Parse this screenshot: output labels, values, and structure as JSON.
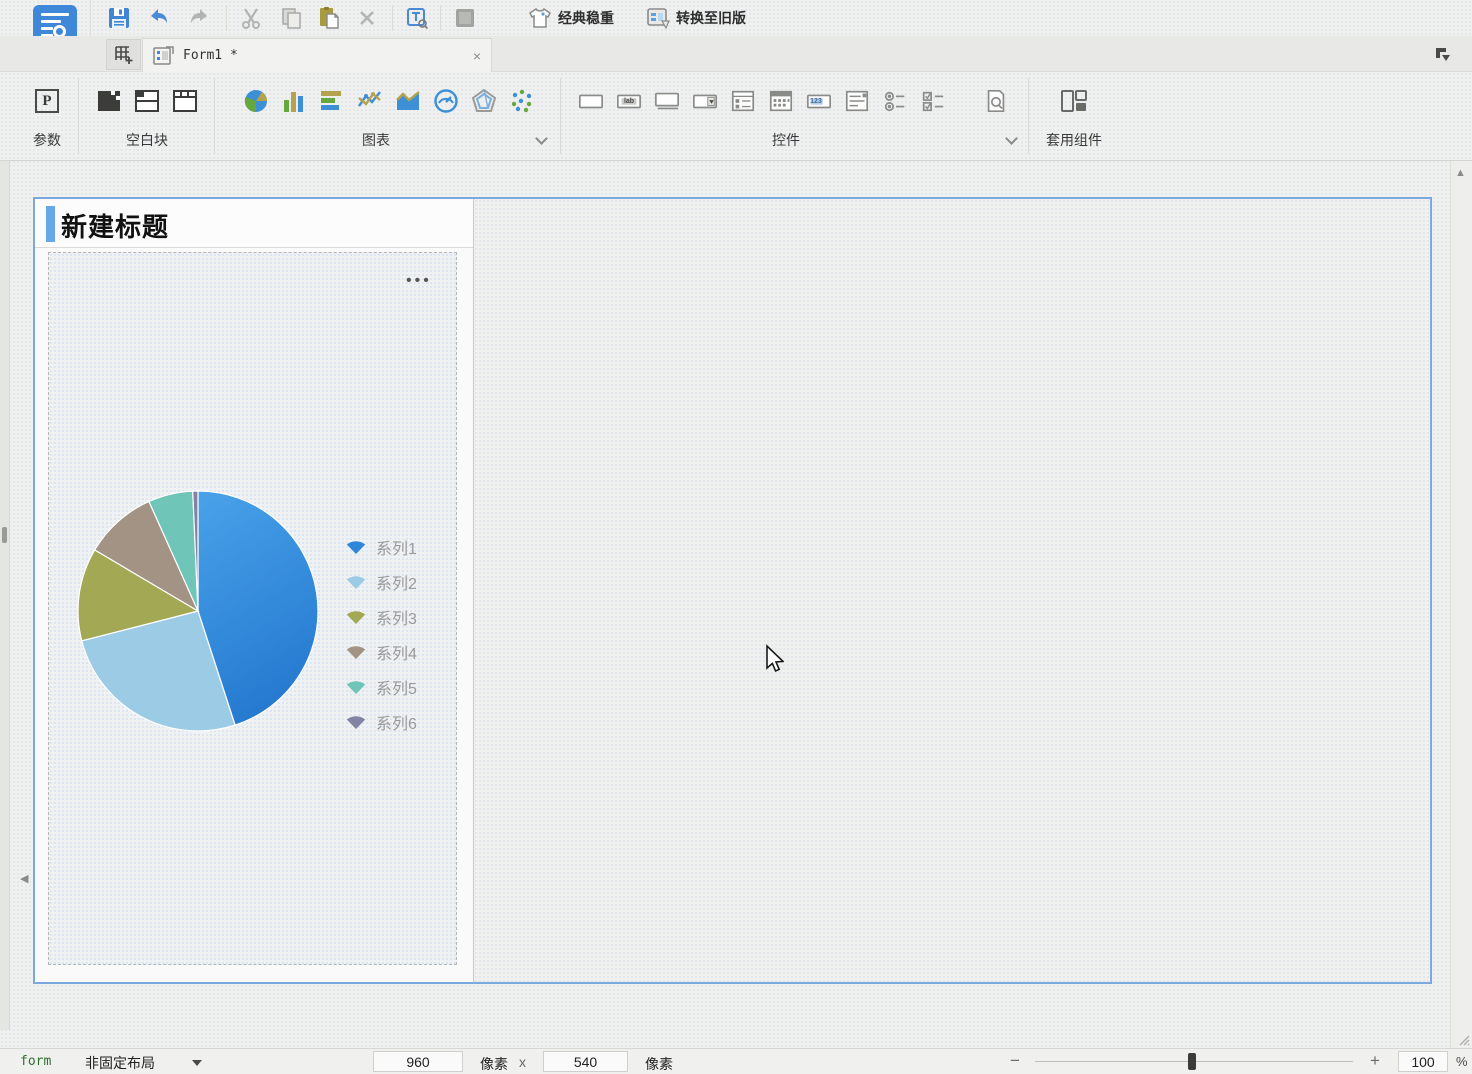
{
  "toolbar": {
    "theme_label": "经典稳重",
    "convert_label": "转换至旧版"
  },
  "tab": {
    "title": "Form1 *",
    "close": "×"
  },
  "ribbon": {
    "groups": [
      {
        "label": "参数"
      },
      {
        "label": "空白块"
      },
      {
        "label": "图表"
      },
      {
        "label": "控件"
      },
      {
        "label": "套用组件"
      }
    ],
    "icon_text": {
      "param_letter": "P",
      "label_text": "lab",
      "number_text": "123"
    }
  },
  "canvas": {
    "block_title": "新建标题",
    "more_label": "•••"
  },
  "chart_data": {
    "type": "pie",
    "title": "",
    "series": [
      "系列1",
      "系列2",
      "系列3",
      "系列4",
      "系列5",
      "系列6"
    ],
    "values": [
      45,
      26,
      12.5,
      9.8,
      6,
      0.7
    ],
    "colors": [
      "#2e86d9",
      "#9ccbe6",
      "#a3a855",
      "#a29384",
      "#6ec5b8",
      "#8183a0"
    ],
    "legend_position": "right",
    "start_angle_deg": 0,
    "direction": "clockwise",
    "legend_text_color": "#9a9a9a"
  },
  "statusbar": {
    "mode": "form",
    "layout": "非固定布局",
    "canvas_width": "960",
    "unit_width": "像素",
    "multiply": "x",
    "canvas_height": "540",
    "unit_height": "像素",
    "zoom_minus": "−",
    "zoom_plus": "+",
    "zoom_value": "100",
    "zoom_unit": "%"
  },
  "scroll": {
    "up": "▲",
    "left": "◀"
  }
}
